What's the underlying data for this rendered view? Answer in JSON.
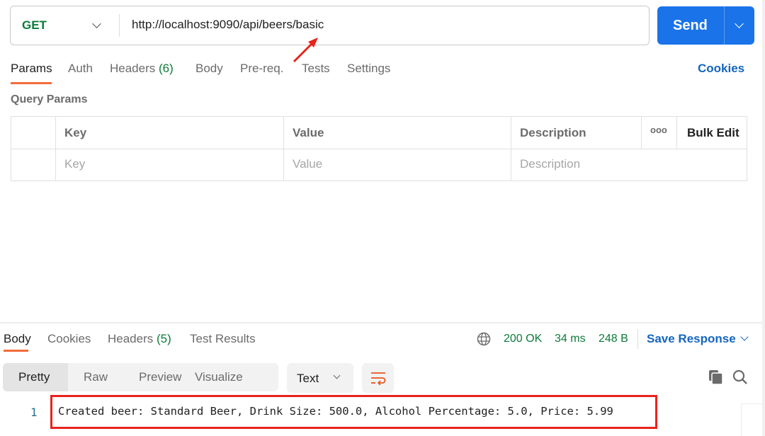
{
  "request": {
    "method": "GET",
    "url": "http://localhost:9090/api/beers/basic",
    "send_label": "Send"
  },
  "request_tabs": [
    {
      "label": "Params",
      "active": true
    },
    {
      "label": "Auth"
    },
    {
      "label": "Headers",
      "count": "(6)"
    },
    {
      "label": "Body"
    },
    {
      "label": "Pre-req."
    },
    {
      "label": "Tests"
    },
    {
      "label": "Settings"
    }
  ],
  "cookies_link": "Cookies",
  "query_params": {
    "title": "Query Params",
    "headers": [
      "Key",
      "Value",
      "Description"
    ],
    "bulk_edit": "Bulk Edit",
    "more": "ooo",
    "placeholders": {
      "key": "Key",
      "value": "Value",
      "description": "Description"
    }
  },
  "response_tabs": [
    {
      "label": "Body",
      "active": true
    },
    {
      "label": "Cookies"
    },
    {
      "label": "Headers",
      "count": "(5)"
    },
    {
      "label": "Test Results"
    }
  ],
  "status": {
    "code": "200 OK",
    "time": "34 ms",
    "size": "248 B",
    "save": "Save Response"
  },
  "view_modes": [
    "Pretty",
    "Raw",
    "Preview",
    "Visualize"
  ],
  "format": "Text",
  "response_body": {
    "line_number": "1",
    "text": "Created beer: Standard Beer, Drink Size: 500.0, Alcohol Percentage: 5.0, Price: 5.99"
  },
  "colors": {
    "accent": "#f26b3a",
    "primary": "#1a73e8",
    "success": "#0b7b3a",
    "annotation": "#e8231c"
  }
}
